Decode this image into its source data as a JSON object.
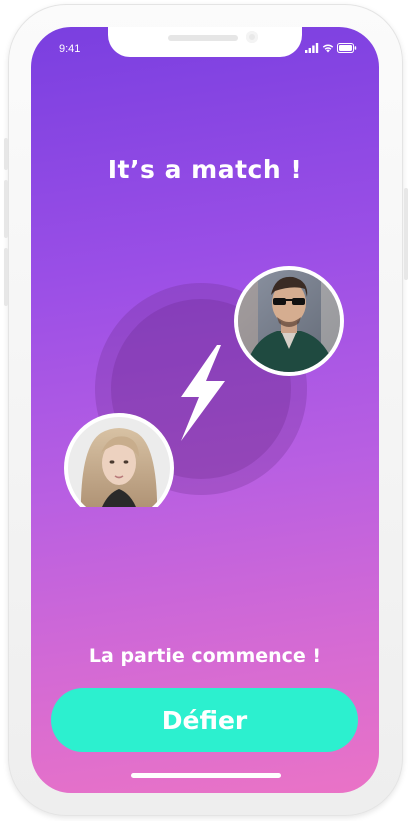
{
  "status_bar": {
    "time": "9:41"
  },
  "match_screen": {
    "title": "It’s a match !",
    "subtitle": "La partie commence !",
    "cta_label": "Défier",
    "accent_color": "#2cf0cf",
    "avatars": [
      "male-avatar",
      "female-avatar"
    ],
    "center_icon": "lightning-bolt-icon"
  }
}
